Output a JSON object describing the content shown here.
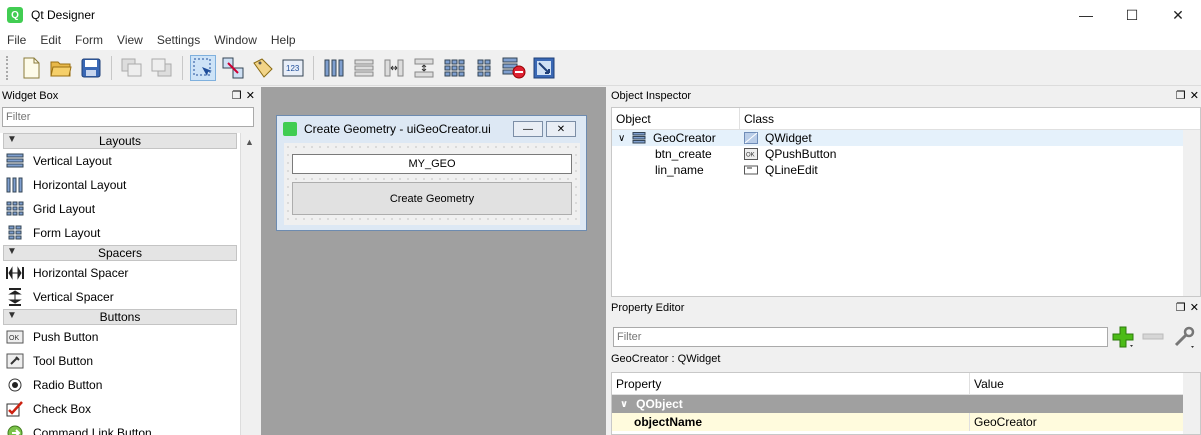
{
  "window": {
    "title": "Qt Designer",
    "minimize": "—",
    "maximize": "☐",
    "close": "✕"
  },
  "menu": [
    "File",
    "Edit",
    "Form",
    "View",
    "Settings",
    "Window",
    "Help"
  ],
  "widget_box": {
    "title": "Widget Box",
    "filter_placeholder": "Filter",
    "categories": {
      "layouts": "Layouts",
      "spacers": "Spacers",
      "buttons": "Buttons"
    },
    "items": {
      "vertical_layout": "Vertical Layout",
      "horizontal_layout": "Horizontal Layout",
      "grid_layout": "Grid Layout",
      "form_layout": "Form Layout",
      "horizontal_spacer": "Horizontal Spacer",
      "vertical_spacer": "Vertical Spacer",
      "push_button": "Push Button",
      "tool_button": "Tool Button",
      "radio_button": "Radio Button",
      "check_box": "Check Box",
      "command_link_button": "Command Link Button"
    }
  },
  "form": {
    "title": "Create Geometry - uiGeoCreator.ui",
    "line_edit_value": "MY_GEO",
    "button_label": "Create Geometry"
  },
  "object_inspector": {
    "title": "Object Inspector",
    "col_object": "Object",
    "col_class": "Class",
    "rows": [
      {
        "object": "GeoCreator",
        "class": "QWidget"
      },
      {
        "object": "btn_create",
        "class": "QPushButton"
      },
      {
        "object": "lin_name",
        "class": "QLineEdit"
      }
    ]
  },
  "property_editor": {
    "title": "Property Editor",
    "filter_placeholder": "Filter",
    "class_label": "GeoCreator : QWidget",
    "col_property": "Property",
    "col_value": "Value",
    "group": "QObject",
    "rows": [
      {
        "property": "objectName",
        "value": "GeoCreator"
      }
    ]
  },
  "colors": {
    "accent_green": "#41cd52",
    "selection": "#cde3f7",
    "mdi_background": "#a0a0a0",
    "property_group": "#a0a0a0",
    "property_row": "#fffbdd"
  }
}
